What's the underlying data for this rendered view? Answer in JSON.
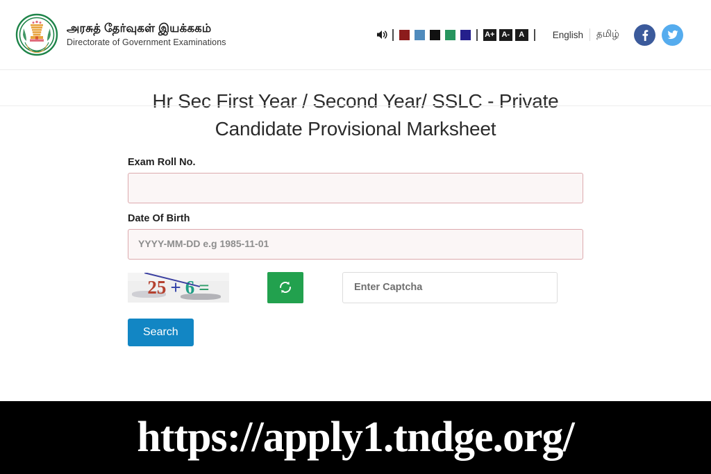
{
  "header": {
    "logo_icon": "tamil-nadu-government-emblem",
    "brand_tamil": "அரசுத் தேர்வுகள் இயக்ககம்",
    "brand_english": "Directorate of Government Examinations",
    "accessibility": {
      "speaker_icon": "speaker-volume-icon",
      "swatches": [
        {
          "name": "theme-dark-red",
          "color": "#8c1c1c"
        },
        {
          "name": "theme-steel-blue",
          "color": "#4f8bbd"
        },
        {
          "name": "theme-black",
          "color": "#111111"
        },
        {
          "name": "theme-green",
          "color": "#27955f"
        },
        {
          "name": "theme-indigo",
          "color": "#241f8c"
        }
      ],
      "font_buttons": [
        {
          "name": "font-increase",
          "label": "A+"
        },
        {
          "name": "font-decrease",
          "label": "A-"
        },
        {
          "name": "font-reset",
          "label": "A"
        }
      ]
    },
    "languages": [
      {
        "name": "lang-english",
        "label": "English"
      },
      {
        "name": "lang-tamil",
        "label": "தமிழ்"
      }
    ],
    "socials": [
      {
        "name": "facebook-icon",
        "glyph": "f",
        "color": "#3b5a9b"
      },
      {
        "name": "twitter-icon",
        "glyph": "twitter-bird",
        "color": "#55acee"
      }
    ]
  },
  "main": {
    "page_title": "Hr Sec First Year / Second Year/ SSLC - Private Candidate Provisional Marksheet",
    "fields": {
      "roll_no": {
        "label": "Exam Roll No.",
        "value": "",
        "placeholder": ""
      },
      "dob": {
        "label": "Date Of Birth",
        "value": "",
        "placeholder": "YYYY-MM-DD e.g 1985-11-01"
      },
      "captcha": {
        "value": "",
        "placeholder": "Enter Captcha"
      }
    },
    "captcha_image": {
      "name": "captcha-image",
      "characters": [
        {
          "text": "25",
          "color": "#b5412f"
        },
        {
          "text": "+",
          "color": "#2f3fa8"
        },
        {
          "text": "6",
          "color": "#1f9e86"
        },
        {
          "text": "=",
          "color": "#2f9e6a"
        }
      ],
      "full_text": "25 + 6 ="
    },
    "refresh_button": {
      "icon": "refresh-icon",
      "color": "#22a14e"
    },
    "search_button": {
      "label": "Search",
      "color": "#1286c4"
    }
  },
  "overlay": {
    "url_text": "https://apply1.tndge.org/"
  }
}
